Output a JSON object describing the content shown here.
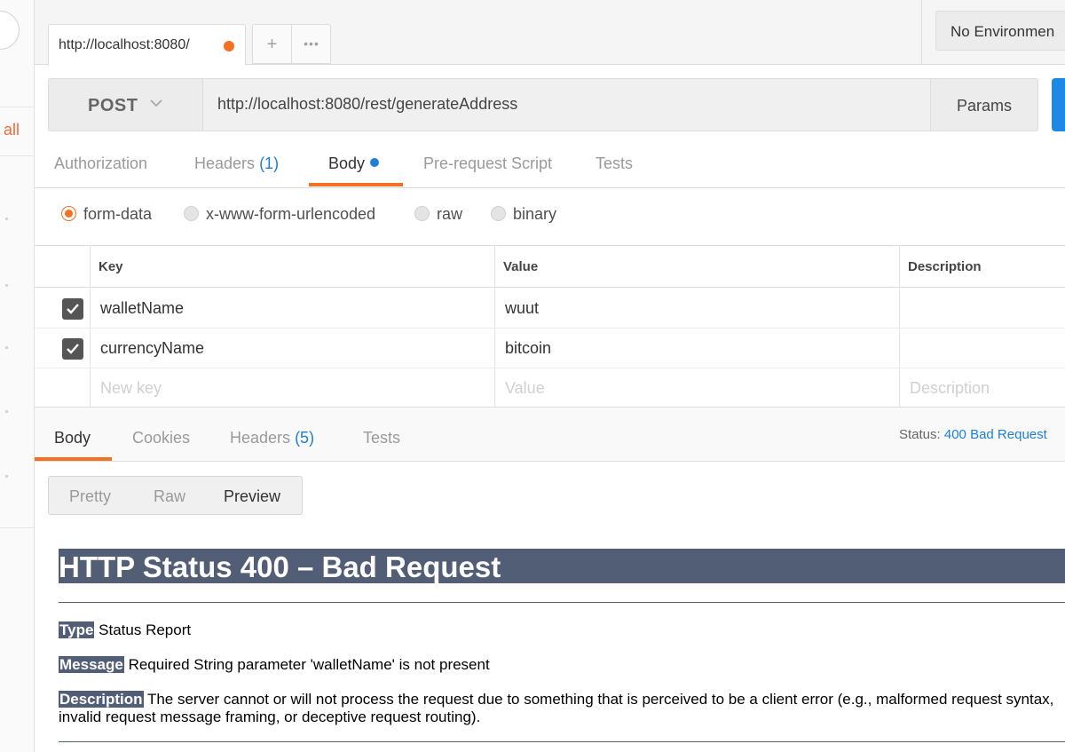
{
  "sidebar": {
    "all_label": "all"
  },
  "tabs": {
    "active_url": "http://localhost:8080/",
    "add_label": "+",
    "more_label": "•••",
    "unsaved_color": "#f47023"
  },
  "environment": {
    "selected": "No Environmen"
  },
  "request": {
    "method": "POST",
    "url": "http://localhost:8080/rest/generateAddress",
    "params_label": "Params"
  },
  "request_tabs": {
    "authorization": "Authorization",
    "headers": "Headers",
    "headers_count": "(1)",
    "body": "Body",
    "prerequest": "Pre-request Script",
    "tests": "Tests"
  },
  "body_types": {
    "form_data": "form-data",
    "urlencoded": "x-www-form-urlencoded",
    "raw": "raw",
    "binary": "binary",
    "selected": "form-data"
  },
  "kv_table": {
    "headers": {
      "key": "Key",
      "value": "Value",
      "description": "Description"
    },
    "rows": [
      {
        "checked": true,
        "key": "walletName",
        "value": "wuut",
        "description": ""
      },
      {
        "checked": true,
        "key": "currencyName",
        "value": "bitcoin",
        "description": ""
      }
    ],
    "placeholders": {
      "key": "New key",
      "value": "Value",
      "description": "Description"
    }
  },
  "response_tabs": {
    "body": "Body",
    "cookies": "Cookies",
    "headers": "Headers",
    "headers_count": "(5)",
    "tests": "Tests"
  },
  "status": {
    "label": "Status:",
    "value": "400 Bad Request"
  },
  "view_modes": {
    "pretty": "Pretty",
    "raw": "Raw",
    "preview": "Preview",
    "selected": "Preview"
  },
  "preview": {
    "heading": "HTTP Status 400 – Bad Request",
    "type_label": "Type",
    "type_value": "Status Report",
    "message_label": "Message",
    "message_value": "Required String parameter 'walletName' is not present",
    "description_label": "Description",
    "description_value": "The server cannot or will not process the request due to something that is perceived to be a client error (e.g., malformed request syntax, invalid request message framing, or deceptive request routing)."
  },
  "colors": {
    "accent": "#f47023",
    "link_blue": "#1e7ed8",
    "send_blue": "#1e88e5",
    "tomcat_bar": "#525d76"
  }
}
